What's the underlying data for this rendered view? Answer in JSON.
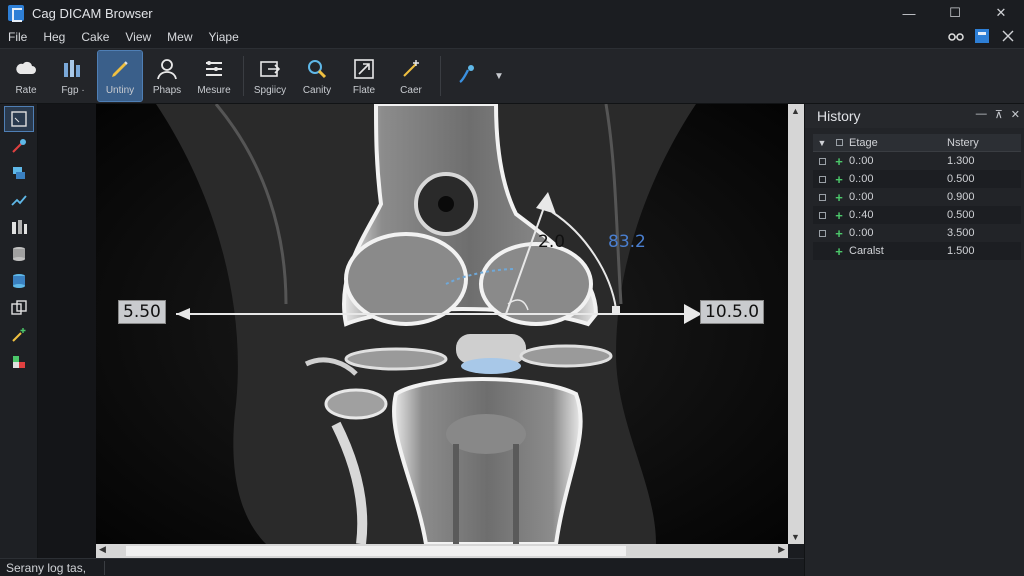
{
  "app": {
    "title": "Cag DICAM Browser",
    "window_controls": [
      "—",
      "☐",
      "✕"
    ]
  },
  "menu": [
    "File",
    "Heg",
    "Cake",
    "View",
    "Mew",
    "Yiape"
  ],
  "toolbar": {
    "tools": [
      {
        "label": "Rate",
        "icon": "cloud-icon"
      },
      {
        "label": "Fgp ·",
        "icon": "bars-icon"
      },
      {
        "label": "Untiny",
        "icon": "pencil-icon",
        "active": true
      },
      {
        "label": "Phaps",
        "icon": "person-icon"
      },
      {
        "label": "Mesure",
        "icon": "list-icon"
      },
      {
        "label": "Spgiicy",
        "icon": "export-icon"
      },
      {
        "label": "Canity",
        "icon": "magnifier-icon"
      },
      {
        "label": "Flate",
        "icon": "arrow-out-icon"
      },
      {
        "label": "Caer",
        "icon": "sparkle-icon"
      },
      {
        "label": "",
        "icon": "wand-icon"
      }
    ]
  },
  "left_tools": [
    "window-icon",
    "eyedropper-icon",
    "layers-icon",
    "annotate-icon",
    "bars-icon",
    "stack-icon",
    "database-icon",
    "copy-icon",
    "magic-icon",
    "palette-icon"
  ],
  "measurements": {
    "left_label": "5.50",
    "right_label": "10.5.0",
    "angle_small": "2.0",
    "angle_large": "83.2"
  },
  "history": {
    "title": "History",
    "controls": [
      "—",
      "⊼",
      "✕"
    ],
    "columns": [
      "Etage",
      "Nstery"
    ],
    "rows": [
      {
        "name": "0.:00",
        "value": "1.300"
      },
      {
        "name": "0.:00",
        "value": "0.500"
      },
      {
        "name": "0.:00",
        "value": "0.900"
      },
      {
        "name": "0.:40",
        "value": "0.500"
      },
      {
        "name": "0.:00",
        "value": "3.500"
      },
      {
        "name": "Caralst",
        "value": "1.500"
      }
    ]
  },
  "status": {
    "text": "Serany log tas,"
  },
  "colors": {
    "accent": "#3a5f8a",
    "plus": "#4cc76a",
    "angle_blue": "#4a7fd0"
  }
}
